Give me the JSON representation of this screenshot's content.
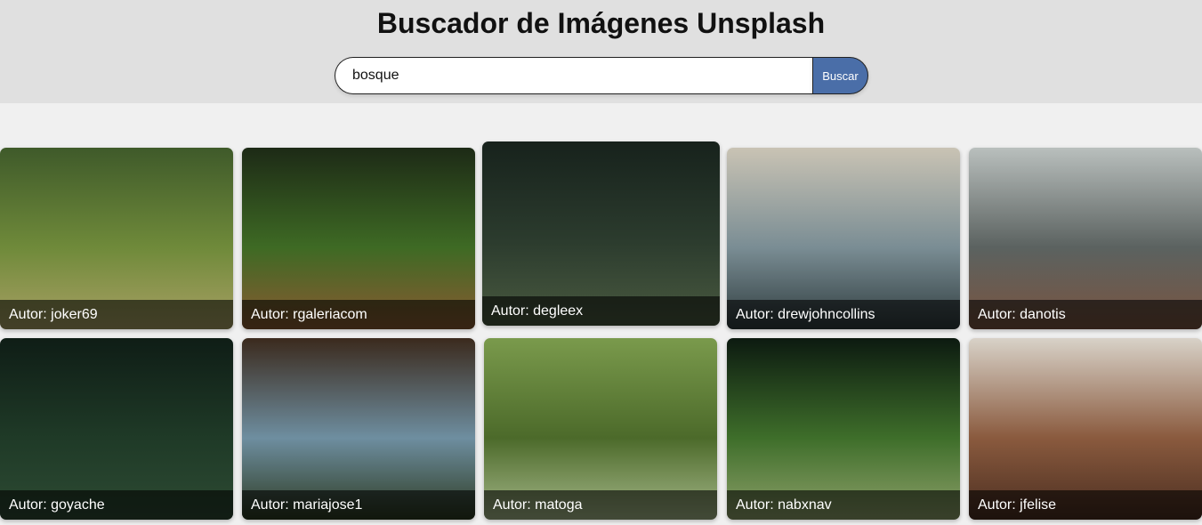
{
  "header": {
    "title": "Buscador de Imágenes Unsplash"
  },
  "search": {
    "value": "bosque",
    "button_label": "Buscar"
  },
  "results": [
    {
      "author": "Autor: joker69",
      "colors": [
        "#3f5a2a",
        "#6f8a3a",
        "#a9a064"
      ]
    },
    {
      "author": "Autor: rgaleriacom",
      "colors": [
        "#1d2a16",
        "#3e6a24",
        "#8b5a32"
      ]
    },
    {
      "author": "Autor: degleex",
      "colors": [
        "#17221c",
        "#2c3c2e",
        "#4a5a40"
      ]
    },
    {
      "author": "Autor: drewjohncollins",
      "colors": [
        "#c9c3b4",
        "#7a8d94",
        "#2f3c3e"
      ]
    },
    {
      "author": "Autor: danotis",
      "colors": [
        "#b9bfbd",
        "#5b6260",
        "#7a5440"
      ]
    },
    {
      "author": "Autor: goyache",
      "colors": [
        "#0f1d16",
        "#1f3a27",
        "#2d4a33"
      ]
    },
    {
      "author": "Autor: mariajose1",
      "colors": [
        "#3b2a1d",
        "#6e8ea0",
        "#2c3a20"
      ]
    },
    {
      "author": "Autor: matoga",
      "colors": [
        "#7a9a4c",
        "#4c6a2a",
        "#a6b88a"
      ]
    },
    {
      "author": "Autor: nabxnav",
      "colors": [
        "#0c1a10",
        "#3e6e2a",
        "#8ea06a"
      ]
    },
    {
      "author": "Autor: jfelise",
      "colors": [
        "#d8d2c8",
        "#8a5a3e",
        "#4a2e20"
      ]
    }
  ]
}
